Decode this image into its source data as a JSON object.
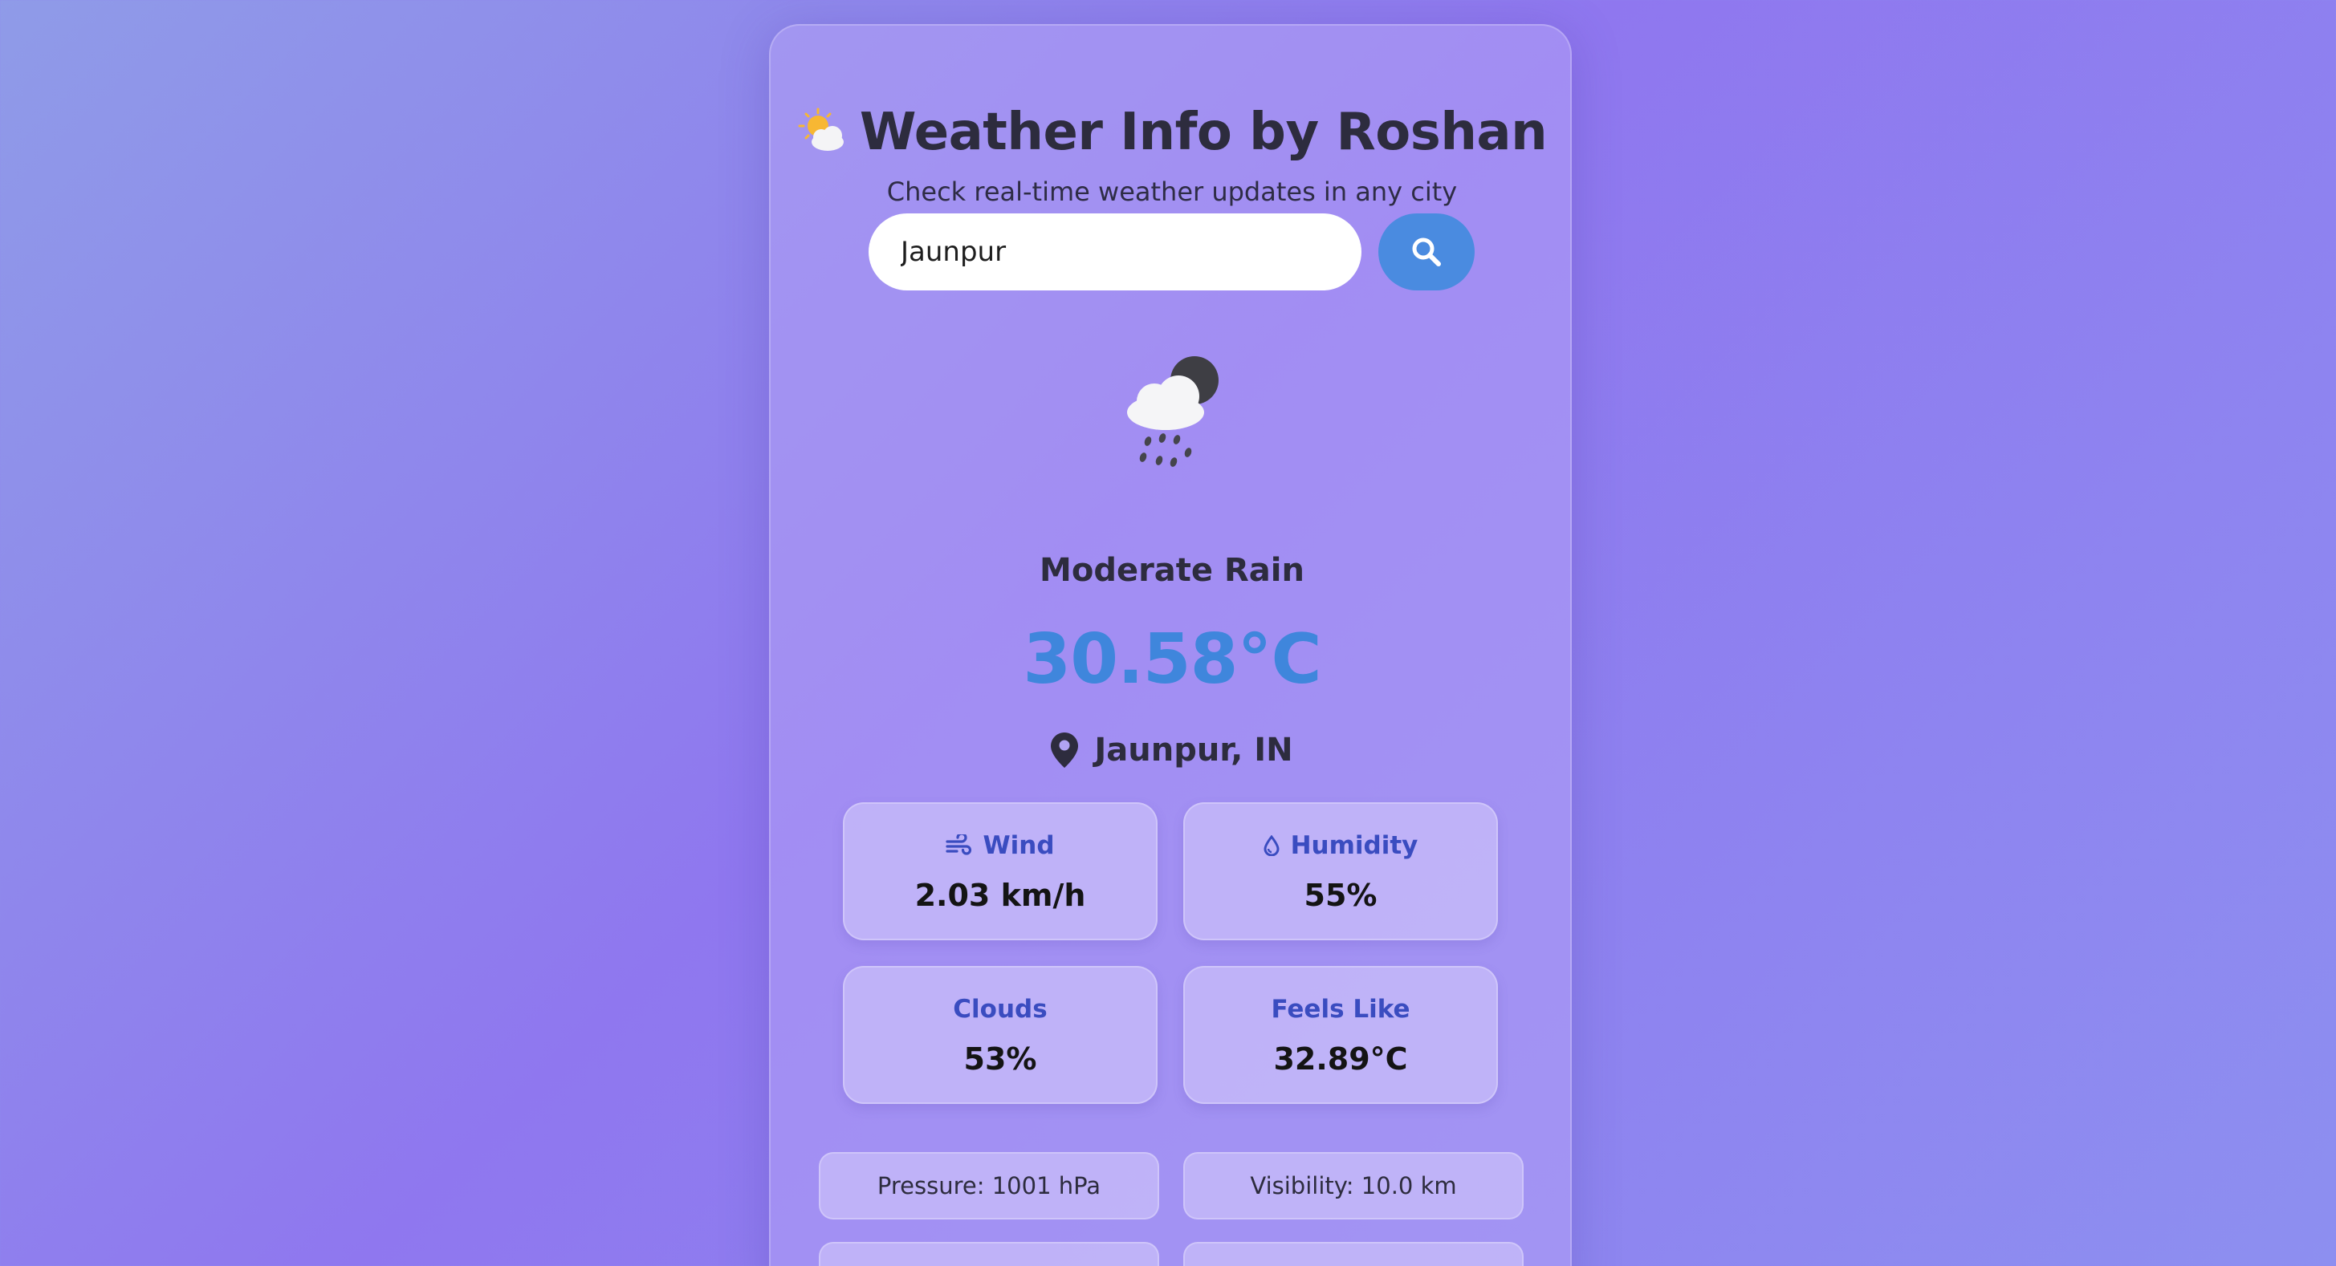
{
  "header": {
    "emoji_icon": "sun-behind-cloud-icon",
    "title": "Weather Info by Roshan",
    "subtitle": "Check real-time weather updates in any city"
  },
  "search": {
    "value": "Jaunpur",
    "button_icon": "search-icon"
  },
  "current": {
    "icon": "cloud-rain-night-icon",
    "condition": "Moderate Rain",
    "temperature": "30.58°C",
    "location": "Jaunpur, IN"
  },
  "stats": [
    {
      "label": "Wind",
      "icon": "wind-icon",
      "value": "2.03 km/h"
    },
    {
      "label": "Humidity",
      "icon": "droplet-icon",
      "value": "55%"
    },
    {
      "label": "Clouds",
      "value": "53%"
    },
    {
      "label": "Feels Like",
      "value": "32.89°C"
    }
  ],
  "details": [
    "Pressure: 1001 hPa",
    "Visibility: 10.0 km"
  ],
  "colors": {
    "accent": "#4a8be0",
    "temperature": "#3f86dc",
    "stat_label": "#3a4cc0"
  }
}
